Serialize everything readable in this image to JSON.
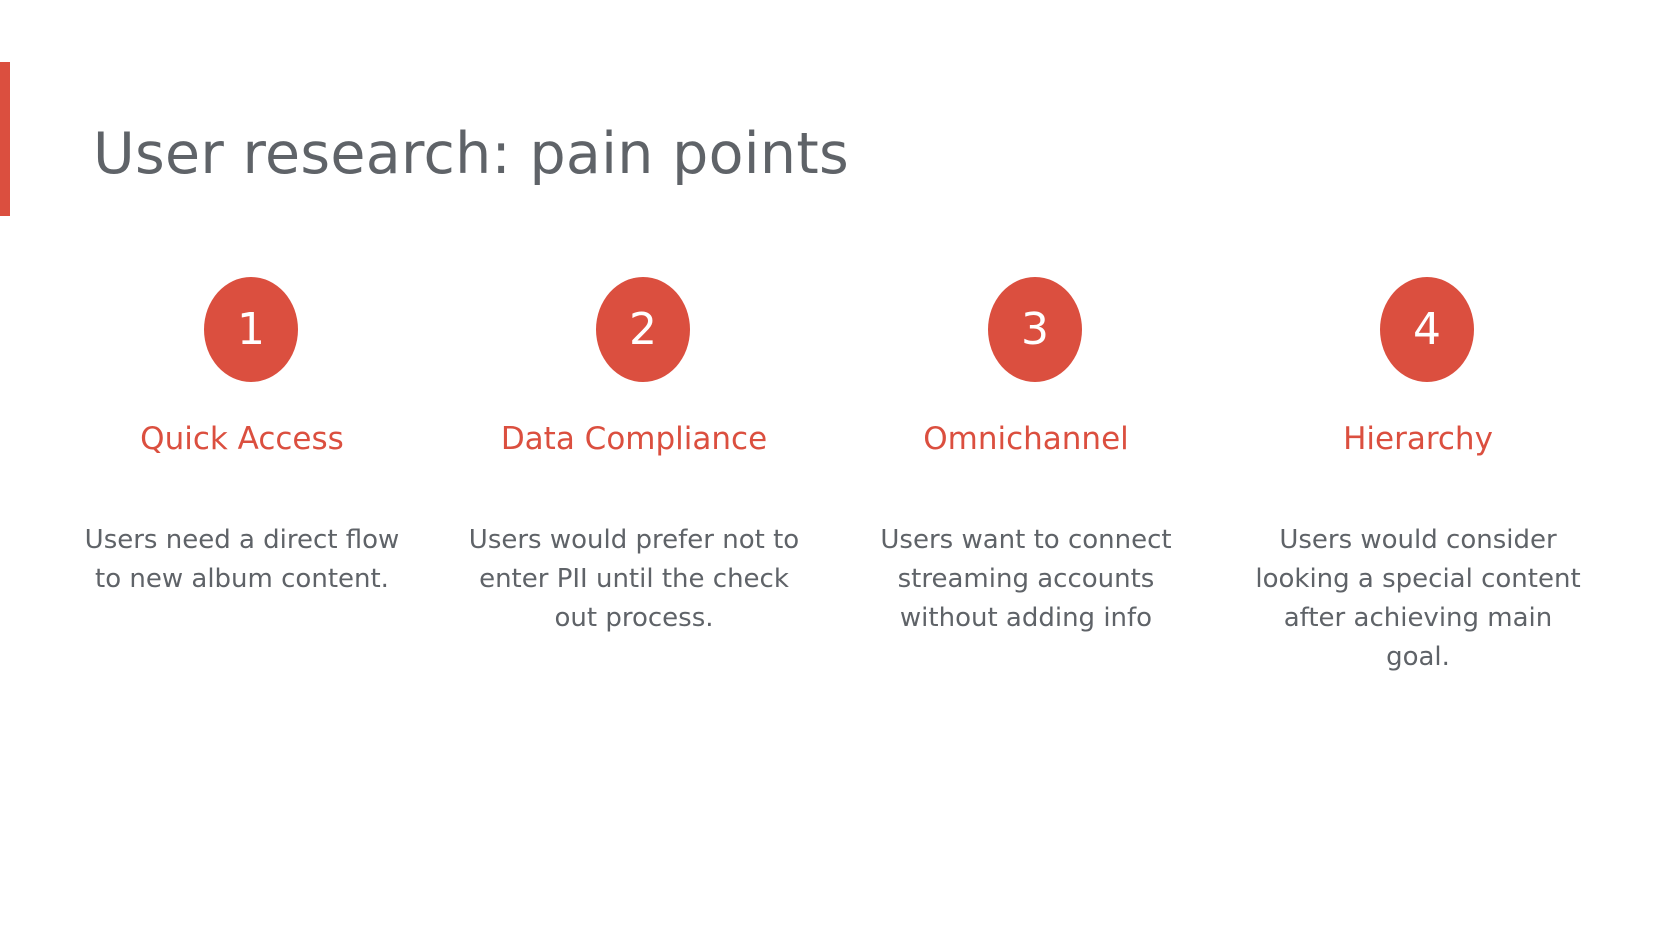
{
  "colors": {
    "accent": "#db4f3f",
    "title_text": "#5f6368",
    "body_text": "#5f6368",
    "background": "#ffffff"
  },
  "slide": {
    "title": "User research: pain points"
  },
  "pain_points": [
    {
      "number": "1",
      "title": "Quick Access",
      "description": "Users need a direct flow to new album content."
    },
    {
      "number": "2",
      "title": "Data Compliance",
      "description": "Users would prefer not to enter PII until the check out process."
    },
    {
      "number": "3",
      "title": "Omnichannel",
      "description": "Users want to connect streaming accounts without adding info"
    },
    {
      "number": "4",
      "title": "Hierarchy",
      "description": "Users would consider looking a special content after achieving main goal."
    }
  ]
}
